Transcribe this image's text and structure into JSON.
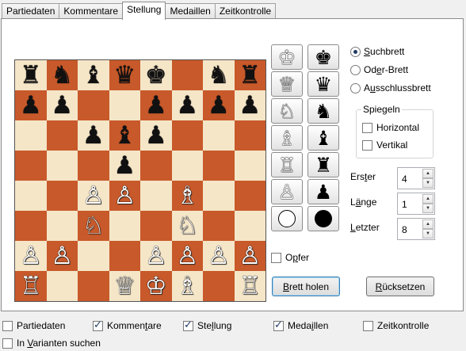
{
  "tabs": [
    {
      "label": "Partiedaten",
      "active": false
    },
    {
      "label": "Kommentare",
      "active": false
    },
    {
      "label": "Stellung",
      "active": true
    },
    {
      "label": "Medaillen",
      "active": false
    },
    {
      "label": "Zeitkontrolle",
      "active": false
    }
  ],
  "board": {
    "light_color": "#f5e6c8",
    "dark_color": "#c8592a",
    "ranks": [
      [
        "r",
        "n",
        "b",
        "",
        "q",
        "k",
        "",
        "n",
        "r"
      ],
      [
        "p",
        "p",
        "",
        "",
        "p",
        "p",
        "p",
        "p"
      ],
      [
        "",
        "",
        "p",
        "b",
        "p",
        "",
        "",
        ""
      ],
      [
        "",
        "",
        "",
        "p",
        "",
        "",
        "",
        ""
      ],
      [
        "",
        "",
        "P",
        "P",
        "",
        "B",
        "",
        ""
      ],
      [
        "",
        "",
        "N",
        "",
        "",
        "N",
        "",
        ""
      ],
      [
        "P",
        "P",
        "",
        "",
        "P",
        "P",
        "P",
        "P"
      ],
      [
        "R",
        "",
        "",
        "Q",
        "K",
        "B",
        "",
        "R"
      ]
    ]
  },
  "piece_buttons": [
    {
      "white": "♔",
      "black": "♚",
      "name": "king"
    },
    {
      "white": "♕",
      "black": "♛",
      "name": "queen"
    },
    {
      "white": "♘",
      "black": "♞",
      "name": "knight"
    },
    {
      "white": "♗",
      "black": "♝",
      "name": "bishop"
    },
    {
      "white": "♖",
      "black": "♜",
      "name": "rook"
    },
    {
      "white": "♙",
      "black": "♟",
      "name": "pawn"
    },
    {
      "white": "",
      "black": "",
      "name": "color"
    }
  ],
  "search_mode": {
    "options": [
      {
        "pre": "",
        "key": "S",
        "post": "uchbrett",
        "selected": true
      },
      {
        "pre": "Od",
        "key": "e",
        "post": "r-Brett",
        "selected": false
      },
      {
        "pre": "A",
        "key": "u",
        "post": "sschlussbrett",
        "selected": false
      }
    ]
  },
  "mirror": {
    "title": "Spiegeln",
    "horizontal": "Horizontal",
    "vertical": "Vertikal"
  },
  "fields": {
    "first": {
      "pre": "Ers",
      "key": "t",
      "post": "er",
      "value": "4"
    },
    "length": {
      "pre": "L",
      "key": "ä",
      "post": "nge",
      "value": "1"
    },
    "last": {
      "pre": "",
      "key": "L",
      "post": "etzter",
      "value": "8"
    }
  },
  "sacrifice": {
    "pre": "O",
    "key": "p",
    "post": "fer"
  },
  "buttons": {
    "get_board": {
      "pre": "",
      "key": "B",
      "post": "rett holen"
    },
    "reset": {
      "pre": "",
      "key": "R",
      "post": "ücksetzen"
    }
  },
  "bottom": {
    "partiedaten": {
      "label": "Partiedaten",
      "checked": false
    },
    "kommentare": {
      "pre": "Kommen",
      "key": "t",
      "post": "are",
      "checked": true
    },
    "stellung": {
      "pre": "Ste",
      "key": "l",
      "post": "lung",
      "checked": true
    },
    "medaillen": {
      "pre": "Meda",
      "key": "i",
      "post": "llen",
      "checked": true
    },
    "zeitkontrolle": {
      "label": "Zeitkontrolle",
      "checked": false
    },
    "varianten": {
      "pre": "In ",
      "key": "V",
      "post": "arianten suchen",
      "checked": false
    }
  }
}
